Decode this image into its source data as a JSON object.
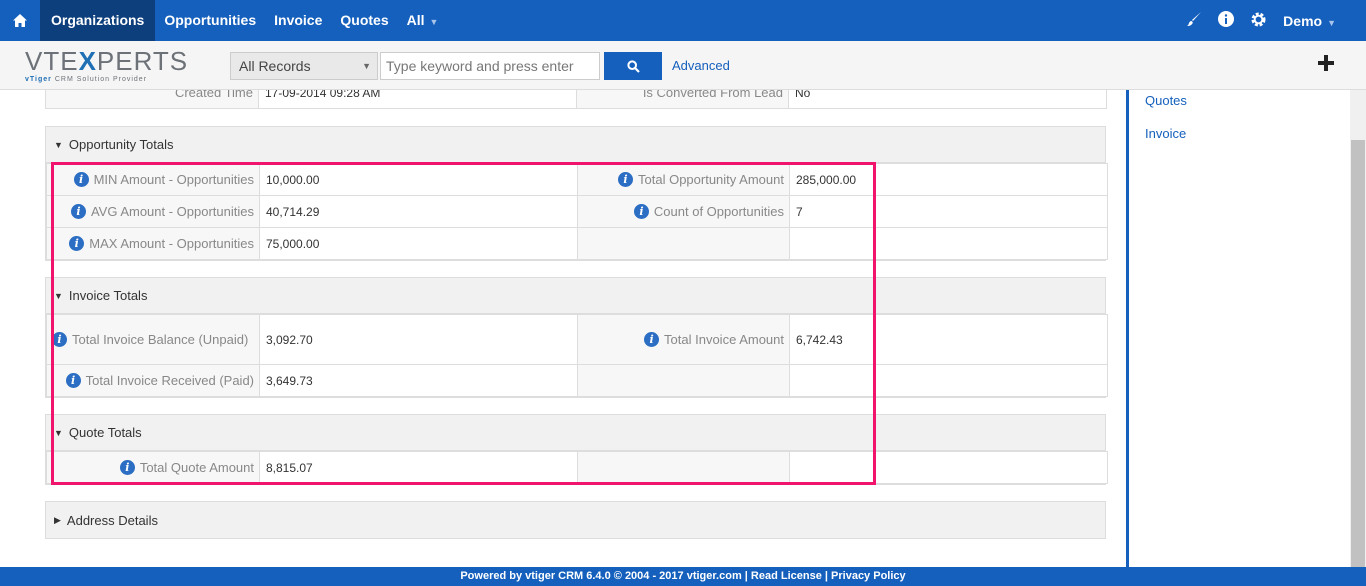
{
  "nav": {
    "items": [
      "Organizations",
      "Opportunities",
      "Invoice",
      "Quotes",
      "All"
    ],
    "user": "Demo"
  },
  "logo": {
    "main_a": "VTE",
    "main_x": "X",
    "main_b": "PERTS",
    "tag_brand": "vTiger",
    "tag_rest": " CRM Solution Provider"
  },
  "search": {
    "select_value": "All Records",
    "placeholder": "Type keyword and press enter",
    "advanced": "Advanced"
  },
  "partial_row": {
    "label1": "Created Time",
    "value1": "17-09-2014 09:28 AM",
    "label2": "Is Converted From Lead",
    "value2": "No"
  },
  "opportunity_totals": {
    "title": "Opportunity Totals",
    "min_label": "MIN Amount - Opportunities",
    "min_value": "10,000.00",
    "total_label": "Total Opportunity Amount",
    "total_value": "285,000.00",
    "avg_label": "AVG Amount - Opportunities",
    "avg_value": "40,714.29",
    "count_label": "Count of Opportunities",
    "count_value": "7",
    "max_label": "MAX Amount - Opportunities",
    "max_value": "75,000.00"
  },
  "invoice_totals": {
    "title": "Invoice Totals",
    "balance_label": "Total Invoice Balance (Unpaid)",
    "balance_value": "3,092.70",
    "amount_label": "Total Invoice Amount",
    "amount_value": "6,742.43",
    "received_label": "Total Invoice Received (Paid)",
    "received_value": "3,649.73"
  },
  "quote_totals": {
    "title": "Quote Totals",
    "amount_label": "Total Quote Amount",
    "amount_value": "8,815.07"
  },
  "address": {
    "title": "Address Details"
  },
  "sidebar": {
    "links": [
      "Quotes",
      "Invoice"
    ]
  },
  "footer": {
    "text": "Powered by vtiger CRM 6.4.0  © 2004 - 2017  vtiger.com | Read License | Privacy Policy"
  },
  "colors": {
    "primary": "#1560bd",
    "highlight": "#f0146c"
  }
}
